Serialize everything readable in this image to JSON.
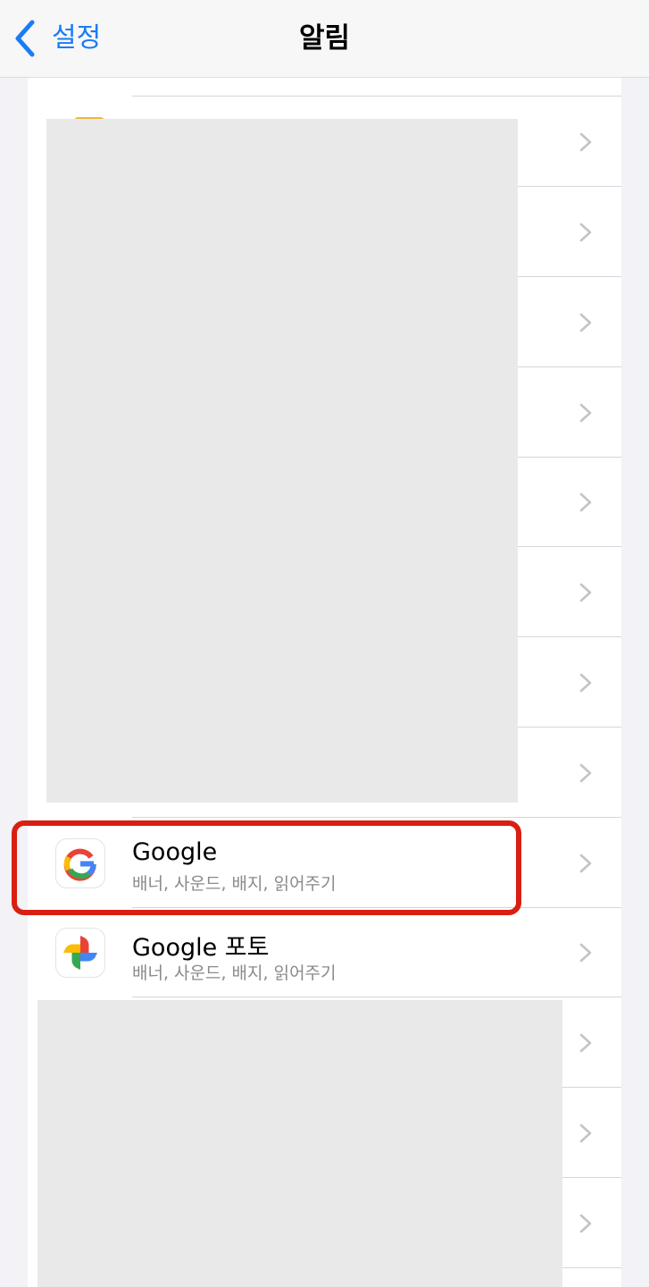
{
  "nav": {
    "back_label": "설정",
    "title": "알림"
  },
  "rows": [
    {
      "title": "Google",
      "subtitle": "배너, 사운드, 배지, 읽어주기",
      "icon": "google-g-icon"
    },
    {
      "title": "Google 포토",
      "subtitle": "배너, 사운드, 배지, 읽어주기",
      "icon": "google-photos-icon"
    }
  ],
  "colors": {
    "accent": "#1a7cf5",
    "highlight": "#d91f11",
    "background": "#f2f2f7",
    "redaction": "#e9e9e9"
  }
}
